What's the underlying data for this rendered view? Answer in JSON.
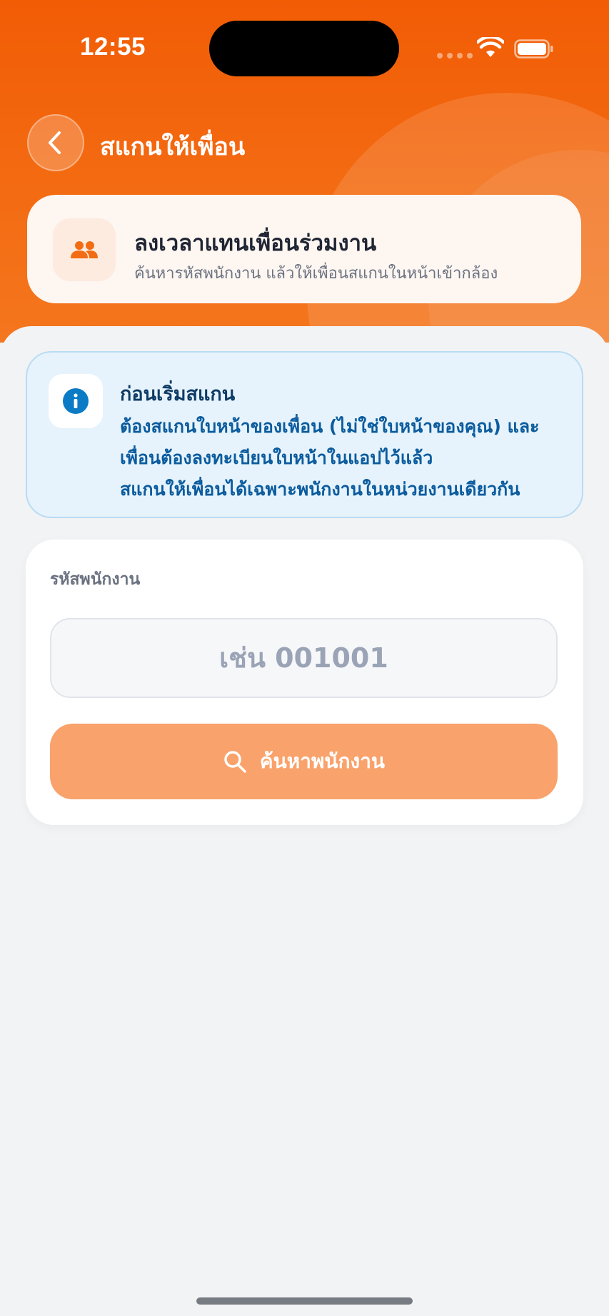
{
  "status_bar": {
    "time": "12:55"
  },
  "nav": {
    "title": "สแกนให้เพื่อน",
    "back_icon": "chevron-left-icon"
  },
  "hero": {
    "icon": "people-icon",
    "title": "ลงเวลาแทนเพื่อนร่วมงาน",
    "subtitle": "ค้นหารหัสพนักงาน แล้วให้เพื่อนสแกนในหน้าเข้ากล้อง"
  },
  "info": {
    "icon": "info-icon",
    "title": "ก่อนเริ่มสแกน",
    "lines": [
      "ต้องสแกนใบหน้าของเพื่อน (ไม่ใช่ใบหน้าของคุณ) และ",
      "เพื่อนต้องลงทะเบียนใบหน้าในแอปไว้แล้ว",
      "สแกนให้เพื่อนได้เฉพาะพนักงานในหน่วยงานเดียวกัน"
    ]
  },
  "form": {
    "label": "รหัสพนักงาน",
    "input_value": "",
    "input_placeholder": "เช่น 001001",
    "search_button_label": "ค้นหาพนักงาน",
    "search_icon": "search-icon"
  },
  "colors": {
    "brand_orange": "#f25c05",
    "button_orange": "#f9a26b",
    "info_blue": "#0b5c9e",
    "info_bg": "#e7f3fc"
  }
}
